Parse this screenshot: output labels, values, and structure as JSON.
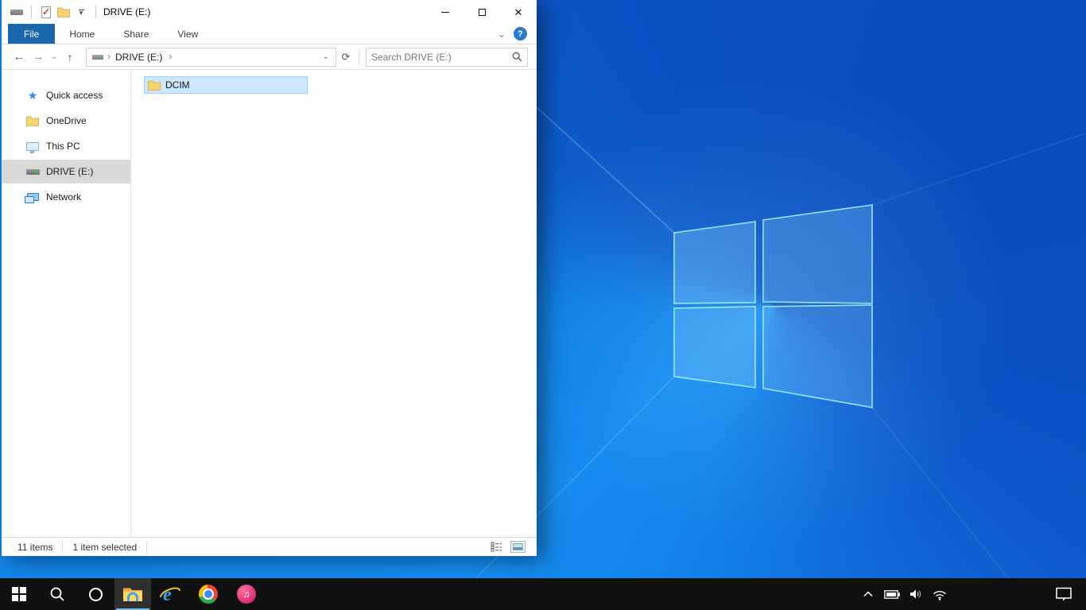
{
  "colors": {
    "accent_file_tab": "#1a66ad",
    "selection_fill": "#cce8ff",
    "selection_border": "#99d1ff",
    "sidebar_selected": "#d9d9d9",
    "taskbar_bg": "#101010",
    "taskbar_active_underline": "#76b9ed",
    "wallpaper_dark": "#0a4dc0",
    "wallpaper_light": "#1486ec"
  },
  "window": {
    "title": "DRIVE (E:)",
    "help_label": "?",
    "qat": {
      "window_icon": "drive-icon",
      "properties_icon": "properties-check-icon",
      "new_folder_icon": "new-folder-icon"
    },
    "tabs": [
      {
        "label": "File",
        "active": true
      },
      {
        "label": "Home",
        "active": false
      },
      {
        "label": "Share",
        "active": false
      },
      {
        "label": "View",
        "active": false
      }
    ],
    "nav": {
      "breadcrumb_root_icon": "drive-icon",
      "breadcrumb": [
        "DRIVE (E:)"
      ],
      "search_placeholder": "Search DRIVE (E:)"
    },
    "sidebar": {
      "items": [
        {
          "label": "Quick access",
          "icon": "quick-access-star",
          "selected": false
        },
        {
          "label": "OneDrive",
          "icon": "onedrive-folder",
          "selected": false
        },
        {
          "label": "This PC",
          "icon": "this-pc-monitor",
          "selected": false
        },
        {
          "label": "DRIVE (E:)",
          "icon": "drive",
          "selected": true
        },
        {
          "label": "Network",
          "icon": "network-computers",
          "selected": false
        }
      ]
    },
    "content": {
      "items": [
        {
          "name": "DCIM",
          "icon": "folder",
          "selected": true
        }
      ]
    },
    "status": {
      "count": "11 items",
      "selection": "1 item selected",
      "view_buttons": [
        "details-view",
        "large-thumbnails-view"
      ]
    }
  },
  "taskbar": {
    "apps": [
      "start",
      "search",
      "cortana",
      "file-explorer (active)",
      "internet-explorer",
      "chrome",
      "itunes"
    ],
    "tray": [
      "hidden-icons-chevron",
      "battery",
      "volume",
      "wifi"
    ],
    "action_center": "action-center"
  }
}
